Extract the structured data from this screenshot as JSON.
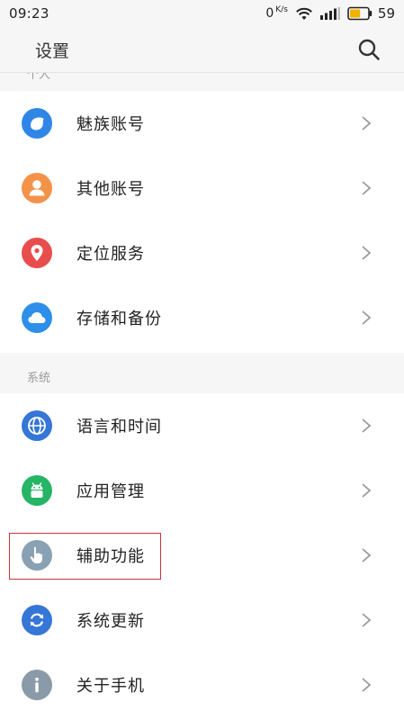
{
  "status_bar": {
    "time": "09:23",
    "net_speed": "0",
    "net_unit": "K/s",
    "battery_level": "59",
    "battery_color": "#f2b300"
  },
  "header": {
    "title": "设置",
    "search_icon": "search-icon"
  },
  "sections": {
    "personal_label": "个人",
    "system_label": "系统"
  },
  "personal_items": [
    {
      "label": "魅族账号",
      "icon": "meizu-account-icon",
      "color": "#2f86e6"
    },
    {
      "label": "其他账号",
      "icon": "person-icon",
      "color": "#f3934a"
    },
    {
      "label": "定位服务",
      "icon": "location-pin-icon",
      "color": "#e84d4d"
    },
    {
      "label": "存储和备份",
      "icon": "cloud-icon",
      "color": "#2e8fe8"
    }
  ],
  "system_items": [
    {
      "label": "语言和时间",
      "icon": "globe-icon",
      "color": "#3576d6"
    },
    {
      "label": "应用管理",
      "icon": "android-icon",
      "color": "#26b466"
    },
    {
      "label": "辅助功能",
      "icon": "hand-pointer-icon",
      "color": "#8aa1b3"
    },
    {
      "label": "系统更新",
      "icon": "refresh-icon",
      "color": "#3576d6"
    },
    {
      "label": "关于手机",
      "icon": "info-icon",
      "color": "#8a9aa9"
    }
  ],
  "highlight": {
    "target": "辅助功能",
    "color": "#c9353a"
  }
}
